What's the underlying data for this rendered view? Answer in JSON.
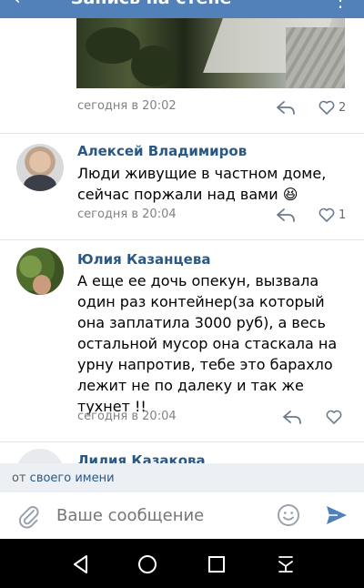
{
  "header": {
    "title": "Запись на стене",
    "back_icon": "arrow-back-icon",
    "more_icon": "more-vertical-icon"
  },
  "colors": {
    "brand": "#5181b8",
    "link": "#2a5885",
    "meta": "#828282"
  },
  "comments": [
    {
      "author": "",
      "text": "",
      "time": "сегодня в 20:02",
      "likes": "2",
      "has_photo": true
    },
    {
      "author": "Алексей Владимиров",
      "text": "Люди живущие в частном доме, сейчас поржали над вами 😆",
      "time": "сегодня в 20:04",
      "likes": "1"
    },
    {
      "author": "Юлия Казанцева",
      "text": "А еще ее дочь опекун, вызвала один раз контейнер(за который она заплатила 3000 руб), а весь остальной мусор она стаскала на урну напротив, тебе это барахло лежит не по далеку и так же тухнет !!",
      "time": "сегодня в 20:04",
      "likes": ""
    },
    {
      "author": "Лилия Казакова"
    }
  ],
  "composer": {
    "from_prefix": "от ",
    "from_link": "своего имени",
    "placeholder": "Ваше сообщение"
  },
  "icons": {
    "attach": "paperclip-icon",
    "emoji": "emoji-icon",
    "send": "send-icon",
    "reply": "reply-icon",
    "like": "heart-icon"
  },
  "navbar": {
    "back": "nav-back-icon",
    "home": "nav-home-icon",
    "recents": "nav-recents-icon",
    "menu": "nav-menu-icon"
  }
}
